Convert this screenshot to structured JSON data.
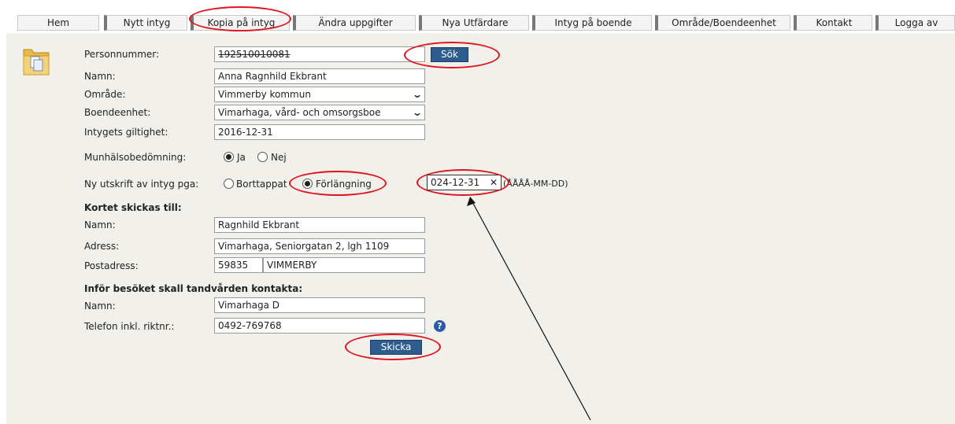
{
  "nav": {
    "tabs": [
      {
        "label": "Hem"
      },
      {
        "label": "Nytt intyg"
      },
      {
        "label": "Kopia på intyg"
      },
      {
        "label": "Ändra uppgifter"
      },
      {
        "label": "Nya Utfärdare"
      },
      {
        "label": "Intyg på boende"
      },
      {
        "label": "Område/Boendeenhet"
      },
      {
        "label": "Kontakt"
      },
      {
        "label": "Logga av"
      }
    ]
  },
  "form": {
    "personnummer": {
      "label": "Personnummer:",
      "value": "192510010081"
    },
    "search_button": "Sök",
    "namn": {
      "label": "Namn:",
      "value": "Anna Ragnhild Ekbrant"
    },
    "omrade": {
      "label": "Område:",
      "value": "Vimmerby kommun"
    },
    "boendeenhet": {
      "label": "Boendeenhet:",
      "value": "Vimarhaga, vård- och omsorgsboe"
    },
    "giltighet": {
      "label": "Intygets giltighet:",
      "value": "2016-12-31"
    },
    "munhalsa": {
      "label": "Munhälsobedömning:",
      "option_yes": "Ja",
      "option_no": "Nej",
      "selected": "Ja"
    },
    "utskrift": {
      "label": "Ny utskrift av intyg pga:",
      "option_lost": "Borttappat",
      "option_extend": "Förlängning",
      "selected": "Förlängning",
      "date_value": "024-12-31",
      "date_hint": "(ÅÅÅÅ-MM-DD)"
    },
    "kortet": {
      "heading": "Kortet skickas till:",
      "namn_label": "Namn:",
      "namn": "Ragnhild Ekbrant",
      "adress_label": "Adress:",
      "adress": "Vimarhaga, Seniorgatan 2, lgh 1109",
      "postadress_label": "Postadress:",
      "postnummer": "59835",
      "ort": "VIMMERBY"
    },
    "kontakt": {
      "heading": "Inför besöket skall tandvården kontakta:",
      "namn_label": "Namn:",
      "namn": "Vimarhaga D",
      "telefon_label": "Telefon inkl. riktnr.:",
      "telefon": "0492-769768"
    },
    "submit_button": "Skicka"
  },
  "icons": {
    "folder": "folder-copy-icon",
    "help": "help-icon",
    "clear": "clear-x-icon",
    "chevron": "chevron-down-icon"
  },
  "colors": {
    "annotation": "#e0141e",
    "button": "#2f5c8f",
    "panel": "#f1f0ea"
  }
}
